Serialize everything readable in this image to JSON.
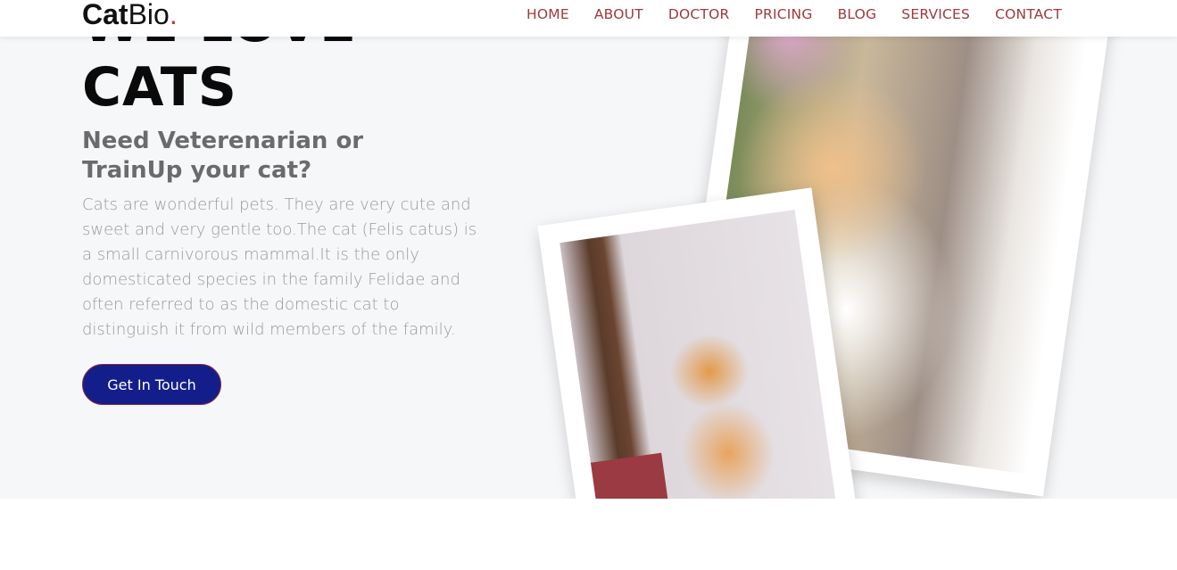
{
  "header": {
    "logo_bold": "Cat",
    "logo_regular": "Bio",
    "logo_dot": ".",
    "nav": [
      "HOME",
      "ABOUT",
      "DOCTOR",
      "PRICING",
      "BLOG",
      "SERVICES",
      "CONTACT"
    ]
  },
  "hero": {
    "title_line1": "WE LOVE",
    "title_line2": "CATS",
    "subtitle": "Need Veterenarian or TrainUp your cat?",
    "description": "Cats are wonderful pets. They are very cute and sweet and very gentle too.The cat (Felis catus) is a small carnivorous mammal.It is the only domesticated species in the family Felidae and often referred to as the domestic cat to distinguish it from wild members of the family.",
    "cta_label": "Get In Touch"
  },
  "colors": {
    "nav_link": "#a0393c",
    "button_bg": "#141e8a",
    "hero_bg": "#f6f7f9"
  }
}
